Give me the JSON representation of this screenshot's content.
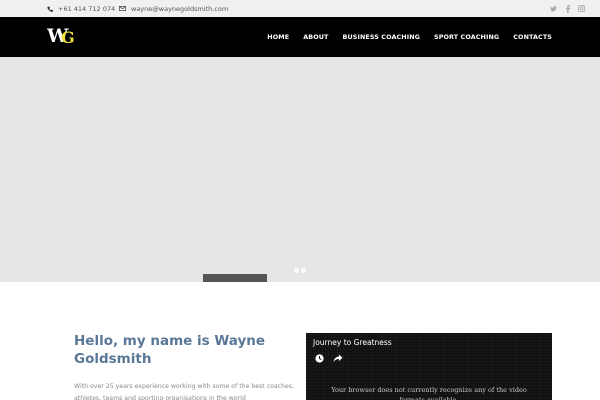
{
  "topbar": {
    "phone": "+61 414 712 074",
    "email": "wayne@waynegoldsmith.com",
    "social": [
      "twitter-icon",
      "facebook-icon",
      "instagram-icon"
    ]
  },
  "header": {
    "logo": {
      "text_w": "W",
      "text_g": "G",
      "color_w": "#ffffff",
      "color_g": "#f2e13a"
    },
    "nav": [
      "HOME",
      "ABOUT",
      "BUSINESS COACHING",
      "SPORT COACHING",
      "CONTACTS"
    ]
  },
  "slider": {
    "dots": 2
  },
  "intro": {
    "title": "Hello, my name is Wayne Goldsmith",
    "text": "With over 25 years experience working with some of the best coaches, athletes, teams and sporting organisations in the world"
  },
  "video": {
    "title": "Journey to Greatness",
    "message": "Your browser does not currently recognize any of the video formats available."
  },
  "colors": {
    "accent": "#5a7896",
    "header_bg": "#000000",
    "slider_bg": "#e6e6e6"
  }
}
